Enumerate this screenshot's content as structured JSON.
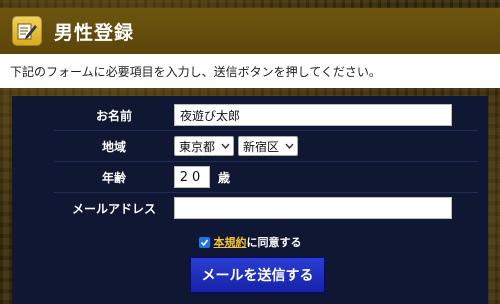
{
  "header": {
    "title": "男性登録",
    "icon": "pencil-note-icon"
  },
  "intro": "下記のフォームに必要項目を入力し、送信ボタンを押してください。",
  "form": {
    "name_label": "お名前",
    "name_value": "夜遊び太郎",
    "region_label": "地域",
    "prefecture_value": "東京都",
    "city_value": "新宿区",
    "age_label": "年齢",
    "age_value": "20",
    "age_unit": "歳",
    "email_label": "メールアドレス",
    "email_value": ""
  },
  "agree": {
    "checked": true,
    "terms_link": "本規約",
    "suffix": "に同意する"
  },
  "submit_label": "メールを送信する",
  "colors": {
    "header_bg": "#5a450a",
    "panel_bg": "#101733",
    "button_bg": "#1622a8",
    "link": "#f3c431"
  }
}
